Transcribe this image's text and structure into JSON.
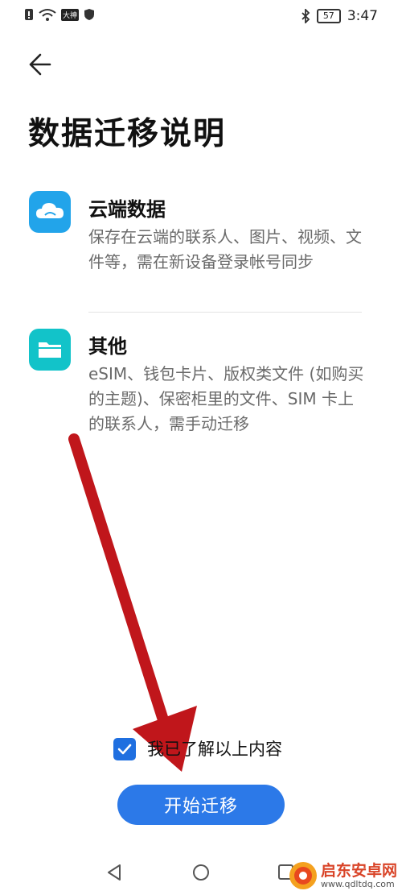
{
  "status_bar": {
    "battery": "57",
    "time": "3:47",
    "carrier_badge": "大神"
  },
  "header": {
    "title": "数据迁移说明"
  },
  "items": [
    {
      "title": "云端数据",
      "desc": "保存在云端的联系人、图片、视频、文件等，需在新设备登录帐号同步",
      "icon": "cloud-icon",
      "color": "#22a4ea"
    },
    {
      "title": "其他",
      "desc": "eSIM、钱包卡片、版权类文件 (如购买的主题)、保密柜里的文件、SIM 卡上的联系人，需手动迁移",
      "icon": "folder-icon",
      "color": "#12c3c9"
    }
  ],
  "agreement": {
    "label": "我已了解以上内容",
    "checked": true
  },
  "start_button": {
    "label": "开始迁移"
  },
  "watermark": {
    "name": "启东安卓网",
    "url": "www.qdltdq.com"
  }
}
